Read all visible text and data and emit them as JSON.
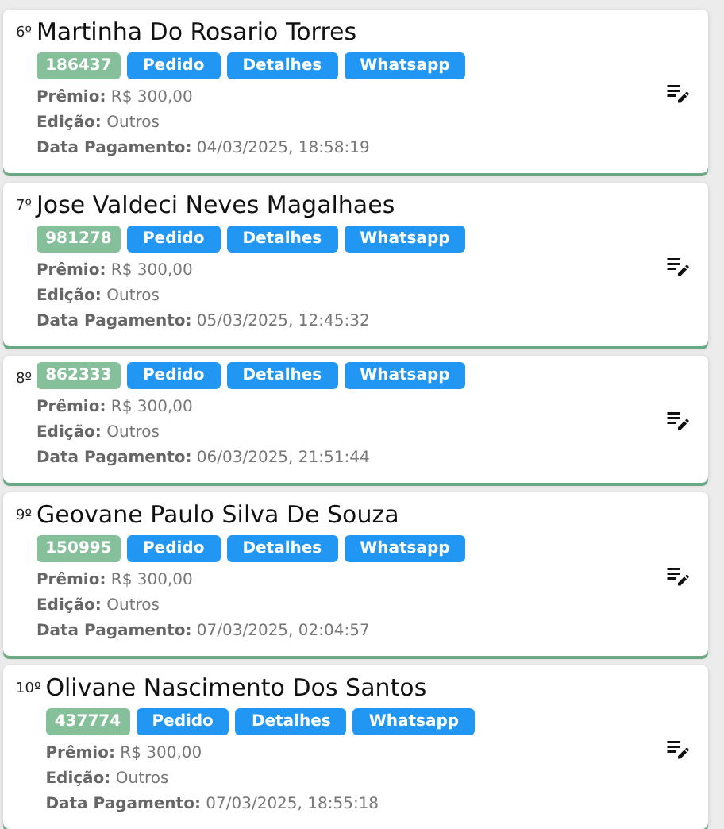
{
  "entries": [
    {
      "rank": "6º",
      "name": "Martinha Do Rosario Torres",
      "code": "186437",
      "buttons": [
        "Pedido",
        "Detalhes",
        "Whatsapp"
      ],
      "fields": [
        {
          "label": "Prêmio:",
          "value": "R$ 300,00"
        },
        {
          "label": "Edição:",
          "value": "Outros"
        },
        {
          "label": "Data Pagamento:",
          "value": "04/03/2025, 18:58:19"
        }
      ]
    },
    {
      "rank": "7º",
      "name": "Jose Valdeci Neves Magalhaes",
      "code": "981278",
      "buttons": [
        "Pedido",
        "Detalhes",
        "Whatsapp"
      ],
      "fields": [
        {
          "label": "Prêmio:",
          "value": "R$ 300,00"
        },
        {
          "label": "Edição:",
          "value": "Outros"
        },
        {
          "label": "Data Pagamento:",
          "value": "05/03/2025, 12:45:32"
        }
      ]
    },
    {
      "rank": "8º",
      "code": "862333",
      "buttons": [
        "Pedido",
        "Detalhes",
        "Whatsapp"
      ],
      "fields": [
        {
          "label": "Prêmio:",
          "value": "R$ 300,00"
        },
        {
          "label": "Edição:",
          "value": "Outros"
        },
        {
          "label": "Data Pagamento:",
          "value": "06/03/2025, 21:51:44"
        }
      ]
    },
    {
      "rank": "9º",
      "name": "Geovane Paulo Silva De Souza",
      "code": "150995",
      "buttons": [
        "Pedido",
        "Detalhes",
        "Whatsapp"
      ],
      "fields": [
        {
          "label": "Prêmio:",
          "value": "R$ 300,00"
        },
        {
          "label": "Edição:",
          "value": "Outros"
        },
        {
          "label": "Data Pagamento:",
          "value": "07/03/2025, 02:04:57"
        }
      ]
    },
    {
      "rank": "10º",
      "name": "Olivane Nascimento Dos Santos",
      "code": "437774",
      "buttons": [
        "Pedido",
        "Detalhes",
        "Whatsapp"
      ],
      "fields": [
        {
          "label": "Prêmio:",
          "value": "R$ 300,00"
        },
        {
          "label": "Edição:",
          "value": "Outros"
        },
        {
          "label": "Data Pagamento:",
          "value": "07/03/2025, 18:55:18"
        }
      ]
    }
  ]
}
